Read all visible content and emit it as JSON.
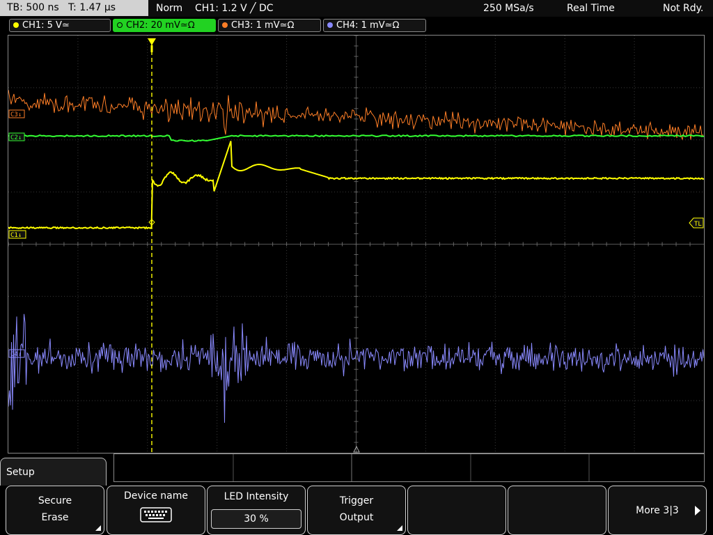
{
  "topbar": {
    "timebase": "TB: 500 ns",
    "trigger_time": "T: 1.47 µs",
    "mode": "Norm",
    "trigger": "CH1: 1.2 V ╱ DC",
    "sample_rate": "250 MSa/s",
    "acq_mode": "Real Time",
    "status": "Not Rdy."
  },
  "channels": [
    {
      "label": "CH1: 5 V≃",
      "color": "#ffff00"
    },
    {
      "label": "CH2: 20 mV≃Ω",
      "color": "#33ff33"
    },
    {
      "label": "CH3: 1 mV≃Ω",
      "color": "#ff7f27"
    },
    {
      "label": "CH4: 1 mV≃Ω",
      "color": "#8a8aff"
    }
  ],
  "markers": {
    "c1": "C1↓",
    "c2": "C2↓",
    "c3": "C3↓",
    "c4": "C4↓",
    "tl": "TL"
  },
  "menu": {
    "title": "Setup",
    "softkeys": [
      {
        "line1": "Secure",
        "line2": "Erase"
      },
      {
        "line1": "Device name",
        "icon": "keyboard-icon"
      },
      {
        "line1": "LED Intensity",
        "value": "30 %"
      },
      {
        "line1": "Trigger",
        "line2": "Output"
      },
      {
        "line1": ""
      },
      {
        "line1": ""
      },
      {
        "line1": "More 3|3"
      }
    ]
  },
  "colors": {
    "ch1": "#ffff00",
    "ch2": "#33ff33",
    "ch3": "#ff7f27",
    "ch4": "#8a8aff",
    "active_tab": "#22d222"
  }
}
